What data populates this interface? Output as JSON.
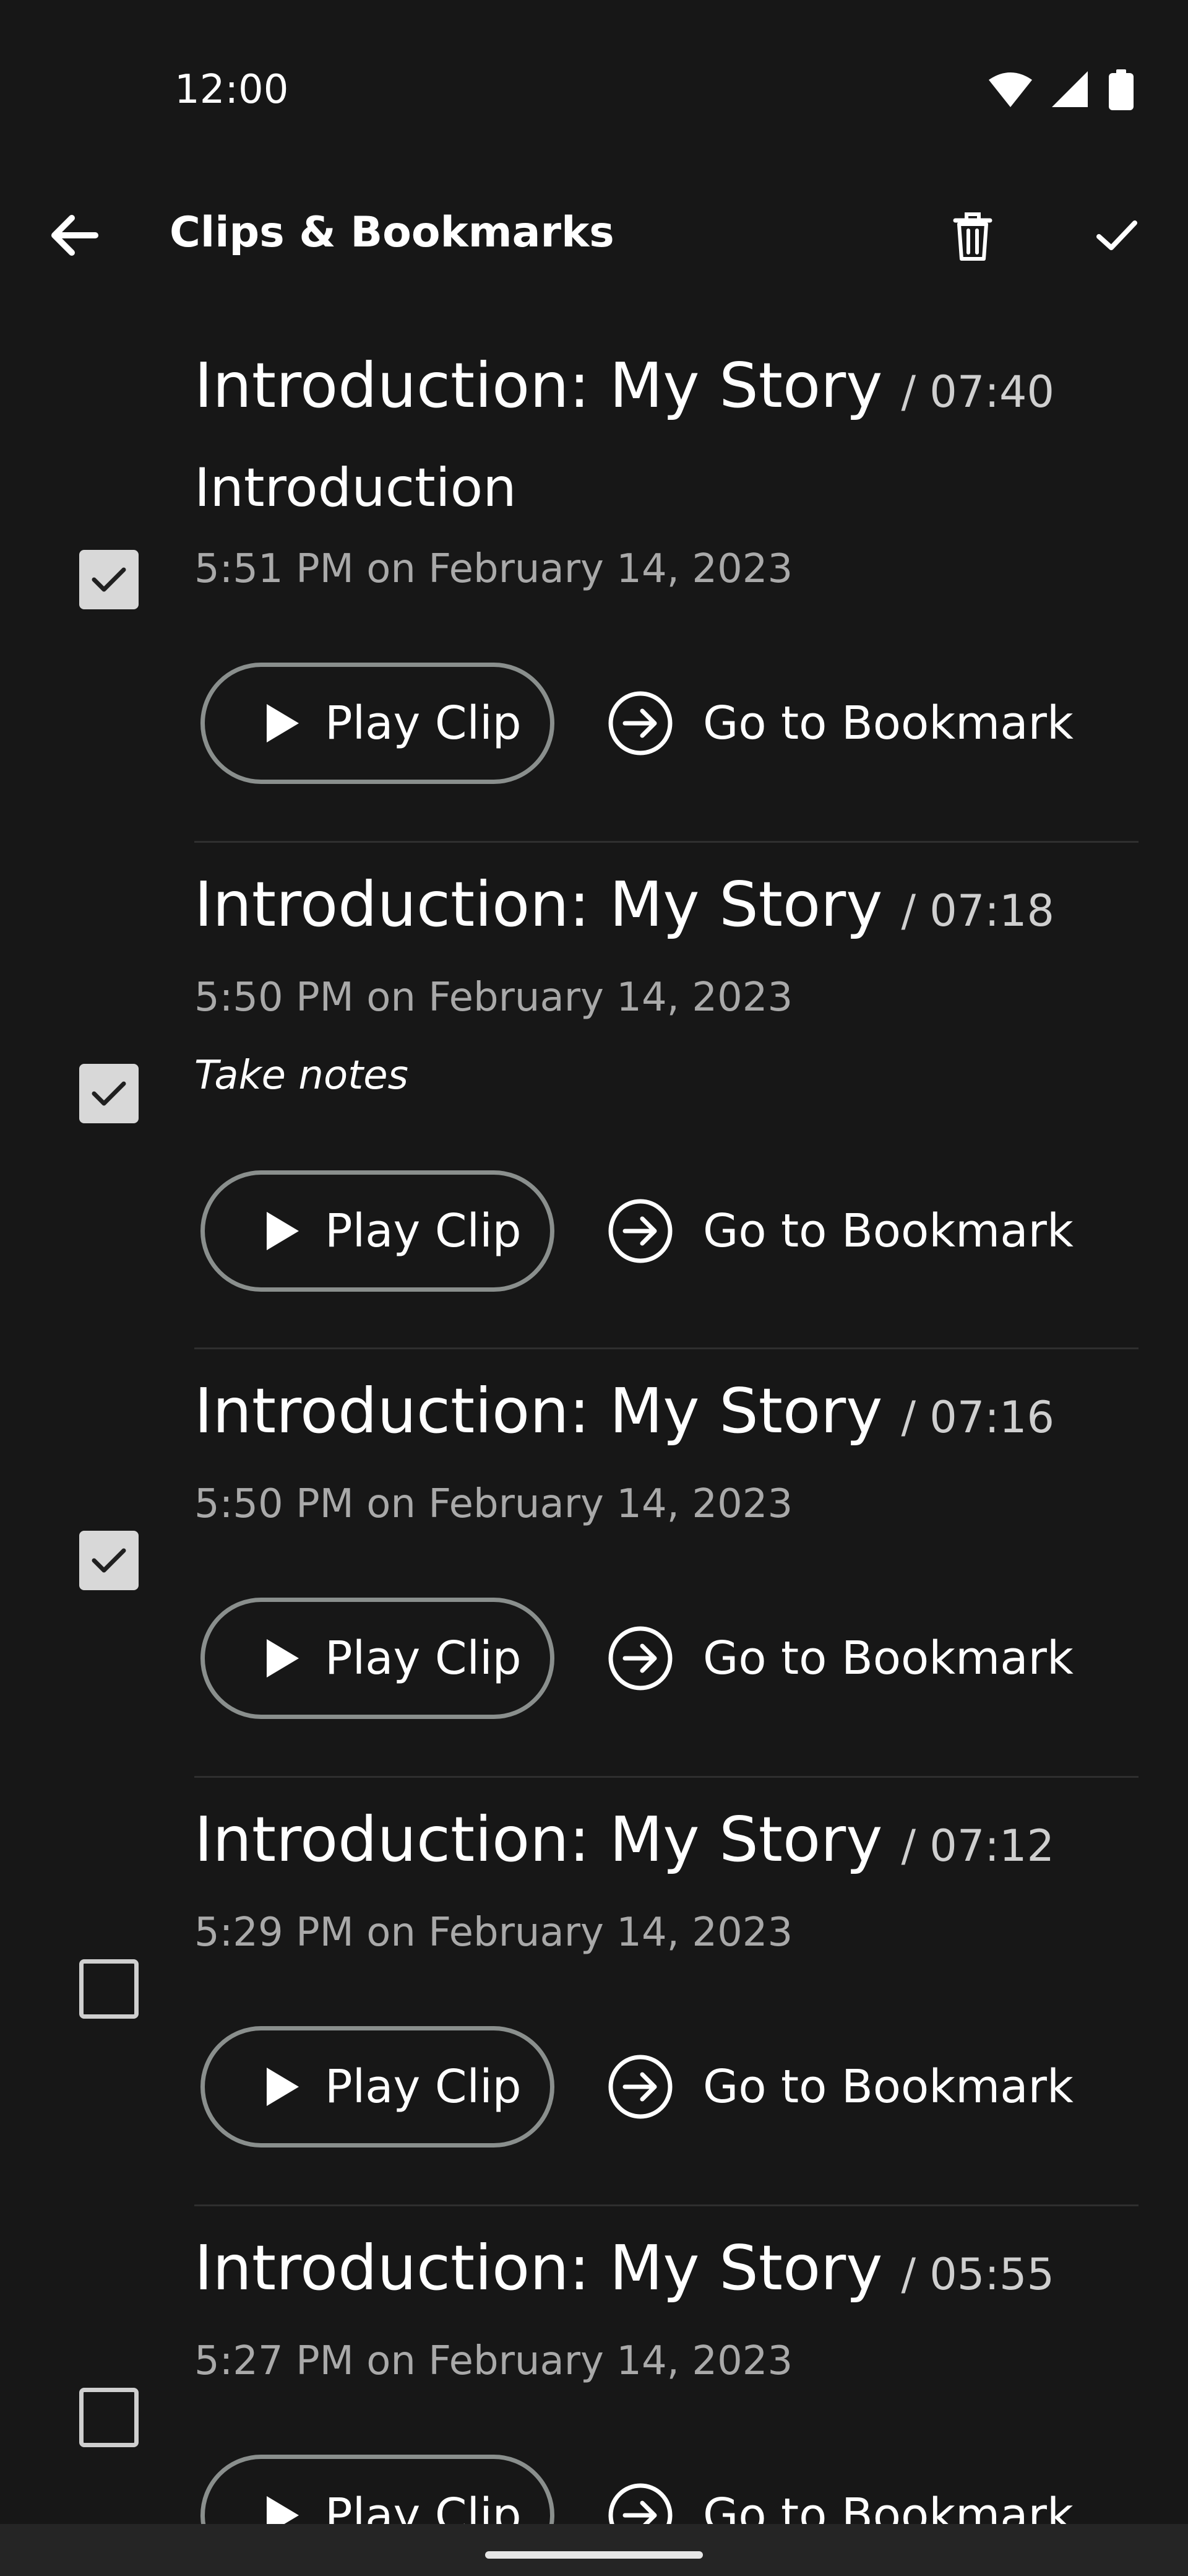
{
  "status_bar": {
    "time": "12:00",
    "icons": [
      "wifi-icon",
      "signal-icon",
      "battery-icon"
    ]
  },
  "toolbar": {
    "title": "Clips & Bookmarks",
    "back_icon": "arrow-back-icon",
    "delete_icon": "trash-icon",
    "confirm_icon": "checkmark-icon"
  },
  "items": [
    {
      "checked": true,
      "title": "Introduction: My Story",
      "duration": "/ 07:40",
      "chapter": "Introduction",
      "date": "5:51 PM on February 14, 2023",
      "note": "",
      "play_label": "Play Clip",
      "goto_label": "Go to Bookmark"
    },
    {
      "checked": true,
      "title": "Introduction: My Story",
      "duration": "/ 07:18",
      "chapter": "",
      "date": "5:50 PM on February 14, 2023",
      "note": "Take notes",
      "play_label": "Play Clip",
      "goto_label": "Go to Bookmark"
    },
    {
      "checked": true,
      "title": "Introduction: My Story",
      "duration": "/ 07:16",
      "chapter": "",
      "date": "5:50 PM on February 14, 2023",
      "note": "",
      "play_label": "Play Clip",
      "goto_label": "Go to Bookmark"
    },
    {
      "checked": false,
      "title": "Introduction: My Story",
      "duration": "/ 07:12",
      "chapter": "",
      "date": "5:29 PM on February 14, 2023",
      "note": "",
      "play_label": "Play Clip",
      "goto_label": "Go to Bookmark"
    },
    {
      "checked": false,
      "title": "Introduction: My Story",
      "duration": "/ 05:55",
      "chapter": "",
      "date": "5:27 PM on February 14, 2023",
      "note": "",
      "play_label": "Play Clip",
      "goto_label": "Go to Bookmark"
    }
  ],
  "colors": {
    "background": "#171717",
    "text": "#ffffff",
    "secondary_text": "#a9a9a9",
    "outline": "#8a8f8d",
    "checkbox_fill": "#d8d8d8"
  }
}
